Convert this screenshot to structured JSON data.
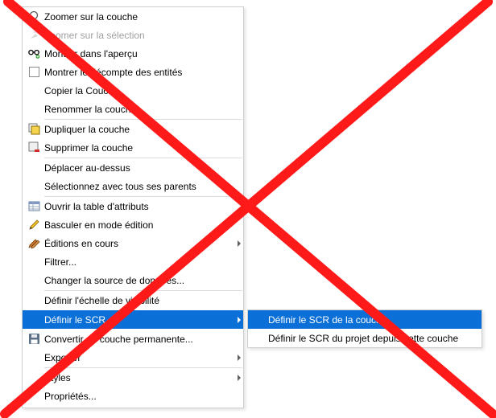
{
  "menu": {
    "items": [
      {
        "label": "Zoomer sur la couche",
        "icon": "zoom-icon",
        "disabled": false
      },
      {
        "label": "Zoomer sur la sélection",
        "icon": "zoom-selection-icon",
        "disabled": true
      },
      {
        "label": "Montrer dans l'aperçu",
        "icon": "overview-glasses-icon",
        "disabled": false
      },
      {
        "label": "Montrer le décompte des entités",
        "icon": "checkbox-icon",
        "disabled": false
      },
      {
        "label": "Copier la Couche",
        "icon": "",
        "disabled": false
      },
      {
        "label": "Renommer la couche",
        "icon": "",
        "disabled": false
      },
      {
        "label": "Dupliquer la couche",
        "icon": "duplicate-layer-icon",
        "disabled": false
      },
      {
        "label": "Supprimer la couche",
        "icon": "remove-layer-icon",
        "disabled": false
      },
      {
        "label": "Déplacer au-dessus",
        "icon": "",
        "disabled": false
      },
      {
        "label": "Sélectionnez avec tous ses parents",
        "icon": "",
        "disabled": false
      },
      {
        "label": "Ouvrir la table d'attributs",
        "icon": "attribute-table-icon",
        "disabled": false
      },
      {
        "label": "Basculer en mode édition",
        "icon": "pencil-icon",
        "disabled": false
      },
      {
        "label": "Éditions en cours",
        "icon": "pencils-icon",
        "disabled": false,
        "submenu": true
      },
      {
        "label": "Filtrer...",
        "icon": "",
        "disabled": false
      },
      {
        "label": "Changer la source de données...",
        "icon": "",
        "disabled": false
      },
      {
        "label": "Définir l'échelle de visibilité",
        "icon": "",
        "disabled": false
      },
      {
        "label": "Définir le SCR",
        "icon": "",
        "disabled": false,
        "submenu": true,
        "active": true
      },
      {
        "label": "Convertir en couche permanente...",
        "icon": "save-icon",
        "disabled": false
      },
      {
        "label": "Exporter",
        "icon": "",
        "disabled": false,
        "submenu": true
      },
      {
        "label": "Styles",
        "icon": "",
        "disabled": false,
        "submenu": true
      },
      {
        "label": "Propriétés...",
        "icon": "",
        "disabled": false
      }
    ]
  },
  "submenu": {
    "items": [
      {
        "label": "Définir le SCR de la couche",
        "active": true
      },
      {
        "label": "Définir le SCR du projet depuis cette couche",
        "active": false
      }
    ]
  },
  "colors": {
    "highlight": "#0a6fd6",
    "cross": "#ff1a1a"
  }
}
